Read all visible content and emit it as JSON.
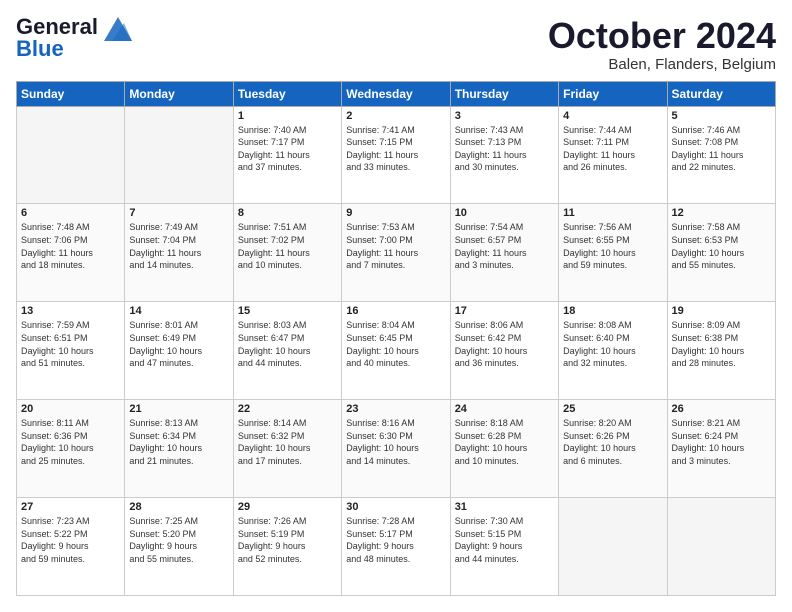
{
  "logo": {
    "line1": "General",
    "line2": "Blue"
  },
  "title": "October 2024",
  "location": "Balen, Flanders, Belgium",
  "weekdays": [
    "Sunday",
    "Monday",
    "Tuesday",
    "Wednesday",
    "Thursday",
    "Friday",
    "Saturday"
  ],
  "weeks": [
    [
      {
        "day": "",
        "info": ""
      },
      {
        "day": "",
        "info": ""
      },
      {
        "day": "1",
        "info": "Sunrise: 7:40 AM\nSunset: 7:17 PM\nDaylight: 11 hours\nand 37 minutes."
      },
      {
        "day": "2",
        "info": "Sunrise: 7:41 AM\nSunset: 7:15 PM\nDaylight: 11 hours\nand 33 minutes."
      },
      {
        "day": "3",
        "info": "Sunrise: 7:43 AM\nSunset: 7:13 PM\nDaylight: 11 hours\nand 30 minutes."
      },
      {
        "day": "4",
        "info": "Sunrise: 7:44 AM\nSunset: 7:11 PM\nDaylight: 11 hours\nand 26 minutes."
      },
      {
        "day": "5",
        "info": "Sunrise: 7:46 AM\nSunset: 7:08 PM\nDaylight: 11 hours\nand 22 minutes."
      }
    ],
    [
      {
        "day": "6",
        "info": "Sunrise: 7:48 AM\nSunset: 7:06 PM\nDaylight: 11 hours\nand 18 minutes."
      },
      {
        "day": "7",
        "info": "Sunrise: 7:49 AM\nSunset: 7:04 PM\nDaylight: 11 hours\nand 14 minutes."
      },
      {
        "day": "8",
        "info": "Sunrise: 7:51 AM\nSunset: 7:02 PM\nDaylight: 11 hours\nand 10 minutes."
      },
      {
        "day": "9",
        "info": "Sunrise: 7:53 AM\nSunset: 7:00 PM\nDaylight: 11 hours\nand 7 minutes."
      },
      {
        "day": "10",
        "info": "Sunrise: 7:54 AM\nSunset: 6:57 PM\nDaylight: 11 hours\nand 3 minutes."
      },
      {
        "day": "11",
        "info": "Sunrise: 7:56 AM\nSunset: 6:55 PM\nDaylight: 10 hours\nand 59 minutes."
      },
      {
        "day": "12",
        "info": "Sunrise: 7:58 AM\nSunset: 6:53 PM\nDaylight: 10 hours\nand 55 minutes."
      }
    ],
    [
      {
        "day": "13",
        "info": "Sunrise: 7:59 AM\nSunset: 6:51 PM\nDaylight: 10 hours\nand 51 minutes."
      },
      {
        "day": "14",
        "info": "Sunrise: 8:01 AM\nSunset: 6:49 PM\nDaylight: 10 hours\nand 47 minutes."
      },
      {
        "day": "15",
        "info": "Sunrise: 8:03 AM\nSunset: 6:47 PM\nDaylight: 10 hours\nand 44 minutes."
      },
      {
        "day": "16",
        "info": "Sunrise: 8:04 AM\nSunset: 6:45 PM\nDaylight: 10 hours\nand 40 minutes."
      },
      {
        "day": "17",
        "info": "Sunrise: 8:06 AM\nSunset: 6:42 PM\nDaylight: 10 hours\nand 36 minutes."
      },
      {
        "day": "18",
        "info": "Sunrise: 8:08 AM\nSunset: 6:40 PM\nDaylight: 10 hours\nand 32 minutes."
      },
      {
        "day": "19",
        "info": "Sunrise: 8:09 AM\nSunset: 6:38 PM\nDaylight: 10 hours\nand 28 minutes."
      }
    ],
    [
      {
        "day": "20",
        "info": "Sunrise: 8:11 AM\nSunset: 6:36 PM\nDaylight: 10 hours\nand 25 minutes."
      },
      {
        "day": "21",
        "info": "Sunrise: 8:13 AM\nSunset: 6:34 PM\nDaylight: 10 hours\nand 21 minutes."
      },
      {
        "day": "22",
        "info": "Sunrise: 8:14 AM\nSunset: 6:32 PM\nDaylight: 10 hours\nand 17 minutes."
      },
      {
        "day": "23",
        "info": "Sunrise: 8:16 AM\nSunset: 6:30 PM\nDaylight: 10 hours\nand 14 minutes."
      },
      {
        "day": "24",
        "info": "Sunrise: 8:18 AM\nSunset: 6:28 PM\nDaylight: 10 hours\nand 10 minutes."
      },
      {
        "day": "25",
        "info": "Sunrise: 8:20 AM\nSunset: 6:26 PM\nDaylight: 10 hours\nand 6 minutes."
      },
      {
        "day": "26",
        "info": "Sunrise: 8:21 AM\nSunset: 6:24 PM\nDaylight: 10 hours\nand 3 minutes."
      }
    ],
    [
      {
        "day": "27",
        "info": "Sunrise: 7:23 AM\nSunset: 5:22 PM\nDaylight: 9 hours\nand 59 minutes."
      },
      {
        "day": "28",
        "info": "Sunrise: 7:25 AM\nSunset: 5:20 PM\nDaylight: 9 hours\nand 55 minutes."
      },
      {
        "day": "29",
        "info": "Sunrise: 7:26 AM\nSunset: 5:19 PM\nDaylight: 9 hours\nand 52 minutes."
      },
      {
        "day": "30",
        "info": "Sunrise: 7:28 AM\nSunset: 5:17 PM\nDaylight: 9 hours\nand 48 minutes."
      },
      {
        "day": "31",
        "info": "Sunrise: 7:30 AM\nSunset: 5:15 PM\nDaylight: 9 hours\nand 44 minutes."
      },
      {
        "day": "",
        "info": ""
      },
      {
        "day": "",
        "info": ""
      }
    ]
  ]
}
